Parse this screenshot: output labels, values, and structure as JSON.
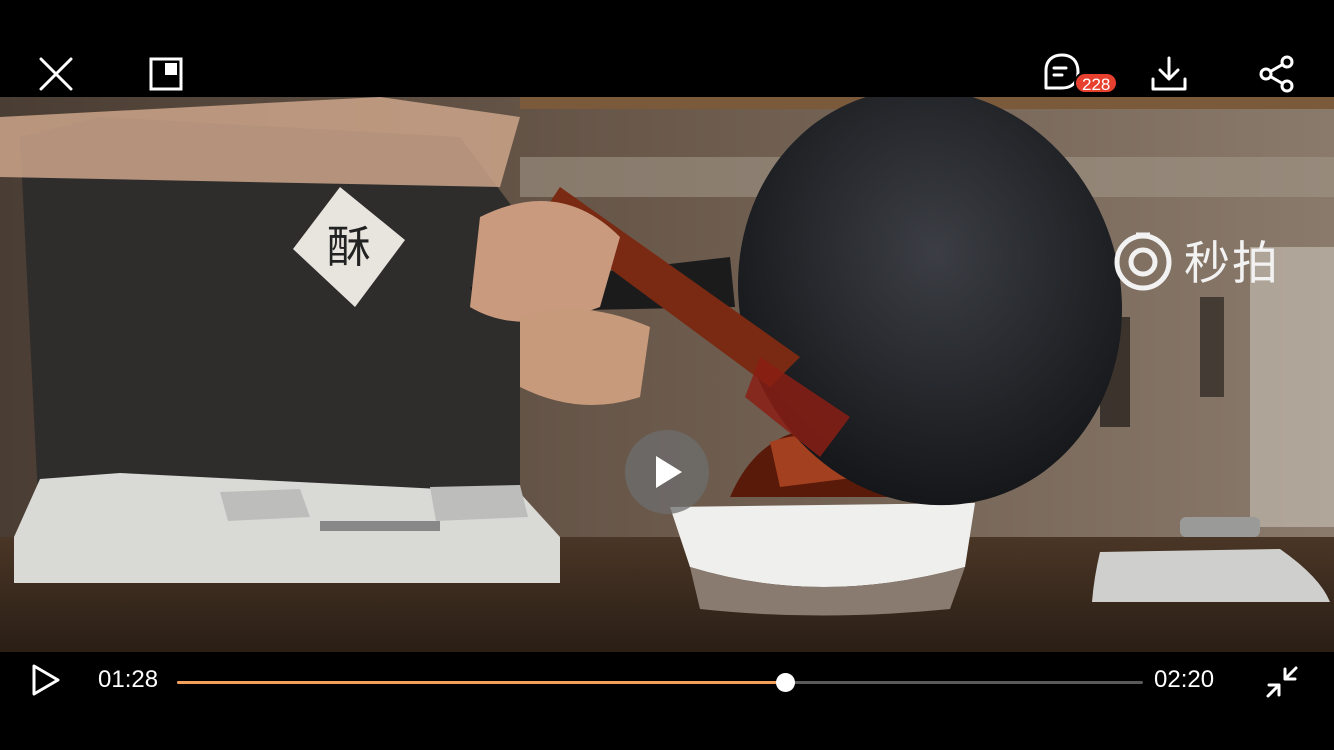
{
  "top_bar": {
    "close_icon": "close-icon",
    "pip_icon": "picture-in-picture-icon",
    "comment_icon": "comment-icon",
    "comment_count": "228",
    "download_icon": "download-icon",
    "share_icon": "share-icon",
    "badge_color": "#e8402e"
  },
  "video": {
    "watermark_text": "秒拍",
    "apron_character": "酥",
    "center_play_icon": "play-icon"
  },
  "controls": {
    "play_icon": "play-icon",
    "current_time": "01:28",
    "total_time": "02:20",
    "progress": 0.629,
    "progress_color": "#f3a05a",
    "exit_fullscreen_icon": "exit-fullscreen-icon"
  }
}
